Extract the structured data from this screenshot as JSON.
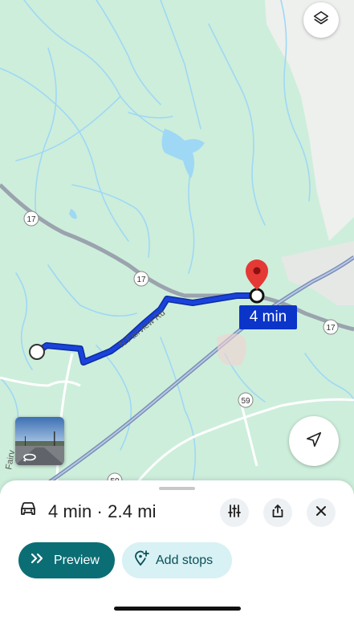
{
  "map": {
    "route_badges": [
      "17",
      "17",
      "17",
      "59",
      "50"
    ],
    "road_labels": [
      "N Fairview Rd",
      "Fairv"
    ],
    "eta_chip": "4 min"
  },
  "controls": {
    "layers_icon": "layers-icon",
    "recenter_icon": "navigation-arrow-icon",
    "streetview_icon": "360-rotate-icon"
  },
  "sheet": {
    "mode_icon": "car-icon",
    "summary": "4 min · 2.4 mi",
    "options_icon": "sliders-icon",
    "share_icon": "share-icon",
    "close_icon": "close-icon",
    "preview_label": "Preview",
    "add_stops_label": "Add stops"
  },
  "colors": {
    "map_green": "#cdeedb",
    "water": "#9fd8f5",
    "route": "#1a43dc",
    "accent": "#0b6e75",
    "pin": "#e53935"
  }
}
